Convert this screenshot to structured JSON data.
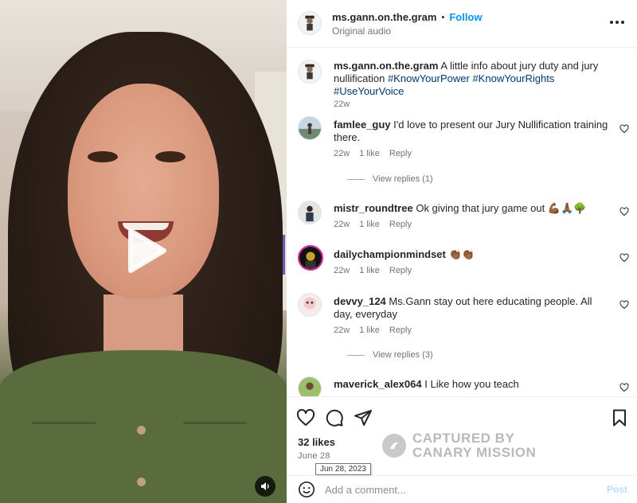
{
  "video": {
    "play_icon": "play-icon",
    "sound_icon": "speaker-icon"
  },
  "header": {
    "username": "ms.gann.on.the.gram",
    "separator": "•",
    "follow_label": "Follow",
    "audio": "Original audio",
    "more_icon": "more-horizontal-icon"
  },
  "caption": {
    "username": "ms.gann.on.the.gram",
    "text": "A little info about jury duty and jury nullification",
    "hashtags": [
      "#KnowYourPower",
      "#KnowYourRights",
      "#UseYourVoice"
    ],
    "age": "22w"
  },
  "comments": [
    {
      "username": "famlee_guy",
      "text": "I'd love to present our Jury Nullification training there.",
      "age": "22w",
      "likes": "1 like",
      "reply": "Reply",
      "view_replies": "View replies (1)"
    },
    {
      "username": "mistr_roundtree",
      "text": "Ok giving that jury game out 💪🏾🙏🏾🌳",
      "age": "22w",
      "likes": "1 like",
      "reply": "Reply"
    },
    {
      "username": "dailychampionmindset",
      "text": "👏🏾👏🏾",
      "age": "22w",
      "likes": "1 like",
      "reply": "Reply"
    },
    {
      "username": "devvy_124",
      "text": "Ms.Gann stay out here educating people. All day, everyday",
      "age": "22w",
      "likes": "1 like",
      "reply": "Reply",
      "view_replies": "View replies (3)"
    },
    {
      "username": "maverick_alex064",
      "text": "I Like how you teach"
    }
  ],
  "actions": {
    "like_icon": "heart-icon",
    "comment_icon": "comment-icon",
    "share_icon": "paper-plane-icon",
    "save_icon": "bookmark-icon"
  },
  "likes_label": "32 likes",
  "date_label": "June 28",
  "date_tooltip": "Jun 28, 2023",
  "watermark": {
    "line1": "CAPTURED BY",
    "line2": "CANARY MISSION"
  },
  "add_comment": {
    "placeholder": "Add a comment...",
    "post_label": "Post",
    "emoji_icon": "smiley-icon"
  }
}
